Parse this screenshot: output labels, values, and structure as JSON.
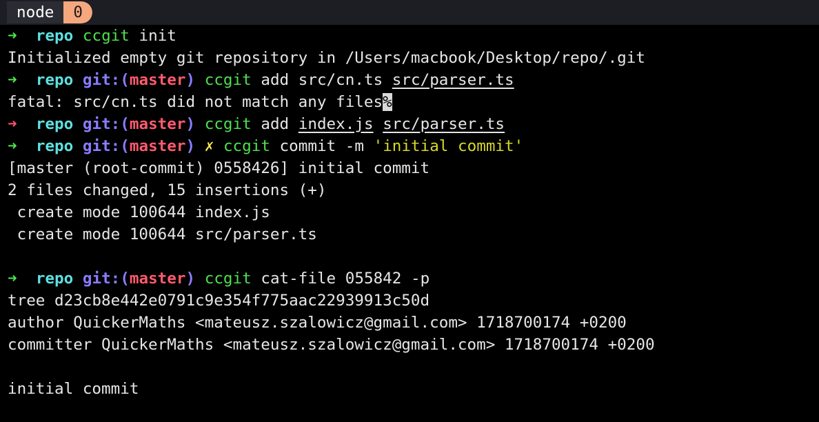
{
  "tab": {
    "name": "node",
    "index": "0"
  },
  "prompt": {
    "arrow": "➜",
    "dir": "repo",
    "git_label_open": "git:(",
    "branch": "master",
    "git_label_close": ")",
    "dirty": "✗"
  },
  "lines": [
    {
      "cmd": "ccgit",
      "args": " init"
    },
    {
      "output": "Initialized empty git repository in /Users/macbook/Desktop/repo/.git"
    },
    {
      "cmd": "ccgit",
      "args_plain": " add src/cn.ts ",
      "args_ul": "src/parser.ts"
    },
    {
      "output": "fatal: src/cn.ts did not match any files",
      "mark": "%"
    },
    {
      "cmd": "ccgit",
      "args_plain": " add ",
      "args_ul1": "index.js",
      "args_sep": " ",
      "args_ul2": "src/parser.ts"
    },
    {
      "cmd": "ccgit",
      "args_plain": " commit -m ",
      "string": "'initial commit'"
    },
    {
      "output": "[master (root-commit) 0558426] initial commit"
    },
    {
      "output": "2 files changed, 15 insertions (+)"
    },
    {
      "output": " create mode 100644 index.js"
    },
    {
      "output": " create mode 100644 src/parser.ts"
    },
    {
      "cmd": "ccgit",
      "args": " cat-file 055842 -p"
    },
    {
      "output": "tree d23cb8e442e0791c9e354f775aac22939913c50d"
    },
    {
      "output": "author QuickerMaths <mateusz.szalowicz@gmail.com> 1718700174 +0200"
    },
    {
      "output": "committer QuickerMaths <mateusz.szalowicz@gmail.com> 1718700174 +0200"
    },
    {
      "output": "initial commit"
    }
  ],
  "colors": {
    "background": "#000000",
    "arrow_success": "#4ee04e",
    "arrow_error": "#ff4f6a",
    "directory": "#5ee0e0",
    "git_label": "#8a7cff",
    "branch": "#ff5a6e",
    "dirty_marker": "#f6e94a",
    "command": "#4ee04e",
    "string": "#d7d72a",
    "tab_index_bg": "#f6a77d"
  }
}
